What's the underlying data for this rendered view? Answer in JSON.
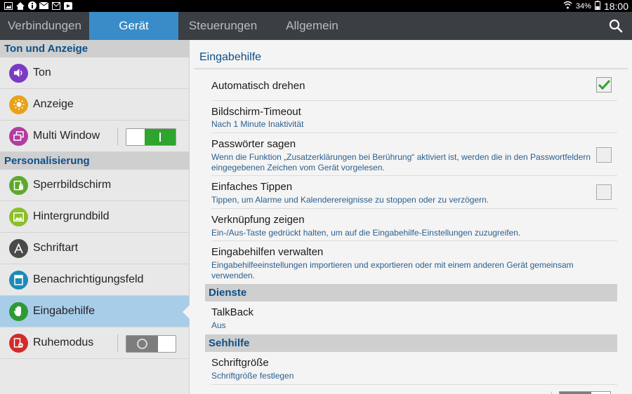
{
  "status_bar": {
    "battery": "34%",
    "time": "18:00",
    "icons": [
      "gallery-icon",
      "home-icon",
      "info-icon",
      "mail-icon",
      "email-icon",
      "youtube-icon"
    ]
  },
  "tabs": [
    {
      "label": "Verbindungen",
      "active": false
    },
    {
      "label": "Gerät",
      "active": true
    },
    {
      "label": "Steuerungen",
      "active": false
    },
    {
      "label": "Allgemein",
      "active": false
    }
  ],
  "left": {
    "section1": "Ton und Anzeige",
    "section2": "Personalisierung",
    "items": [
      {
        "label": "Ton",
        "icon": "speaker-icon",
        "color": "#7a3bc2"
      },
      {
        "label": "Anzeige",
        "icon": "brightness-icon",
        "color": "#e8a21a"
      },
      {
        "label": "Multi Window",
        "icon": "multi-window-icon",
        "color": "#b23ca0",
        "toggle": "on"
      },
      {
        "label": "Sperrbildschirm",
        "icon": "lock-screen-icon",
        "color": "#5fa82c"
      },
      {
        "label": "Hintergrundbild",
        "icon": "wallpaper-icon",
        "color": "#8cbf2a"
      },
      {
        "label": "Schriftart",
        "icon": "font-icon",
        "color": "#4a4a4a"
      },
      {
        "label": "Benachrichtigungsfeld",
        "icon": "notification-panel-icon",
        "color": "#1d8bb8"
      },
      {
        "label": "Eingabehilfe",
        "icon": "hand-icon",
        "color": "#2e9a35",
        "selected": true
      },
      {
        "label": "Ruhemodus",
        "icon": "blocking-mode-icon",
        "color": "#d22b2b",
        "toggle": "off"
      }
    ]
  },
  "right": {
    "title": "Eingabehilfe",
    "rows": [
      {
        "title": "Automatisch drehen",
        "sub": "",
        "checkbox": "checked"
      },
      {
        "title": "Bildschirm-Timeout",
        "sub": "Nach 1 Minute Inaktivität"
      },
      {
        "title": "Passwörter sagen",
        "sub": "Wenn die Funktion „Zusatzerklärungen bei Berührung“ aktiviert ist, werden die in den Passwortfeldern eingegebenen Zeichen vom Gerät vorgelesen.",
        "checkbox": "unchecked"
      },
      {
        "title": "Einfaches Tippen",
        "sub": "Tippen, um Alarme und Kalenderereignisse zu stoppen oder zu verzögern.",
        "checkbox": "unchecked"
      },
      {
        "title": "Verknüpfung zeigen",
        "sub": "Ein-/Aus-Taste gedrückt halten, um auf die Eingabehilfe-Einstellungen zuzugreifen."
      },
      {
        "title": "Eingabehilfen verwalten",
        "sub": "Eingabehilfeeinstellungen importieren und exportieren oder mit einem anderen Gerät gemeinsam verwenden."
      }
    ],
    "dienste_header": "Dienste",
    "talkback": {
      "title": "TalkBack",
      "sub": "Aus"
    },
    "sehhilfe_header": "Sehhilfe",
    "schriftgroesse": {
      "title": "Schriftgröße",
      "sub": "Schriftgröße festlegen"
    }
  },
  "colors": {
    "accent": "#3a8cc9",
    "section_text": "#0e4f87",
    "toggle_on": "#2ea52e",
    "check": "#2ea52e"
  }
}
